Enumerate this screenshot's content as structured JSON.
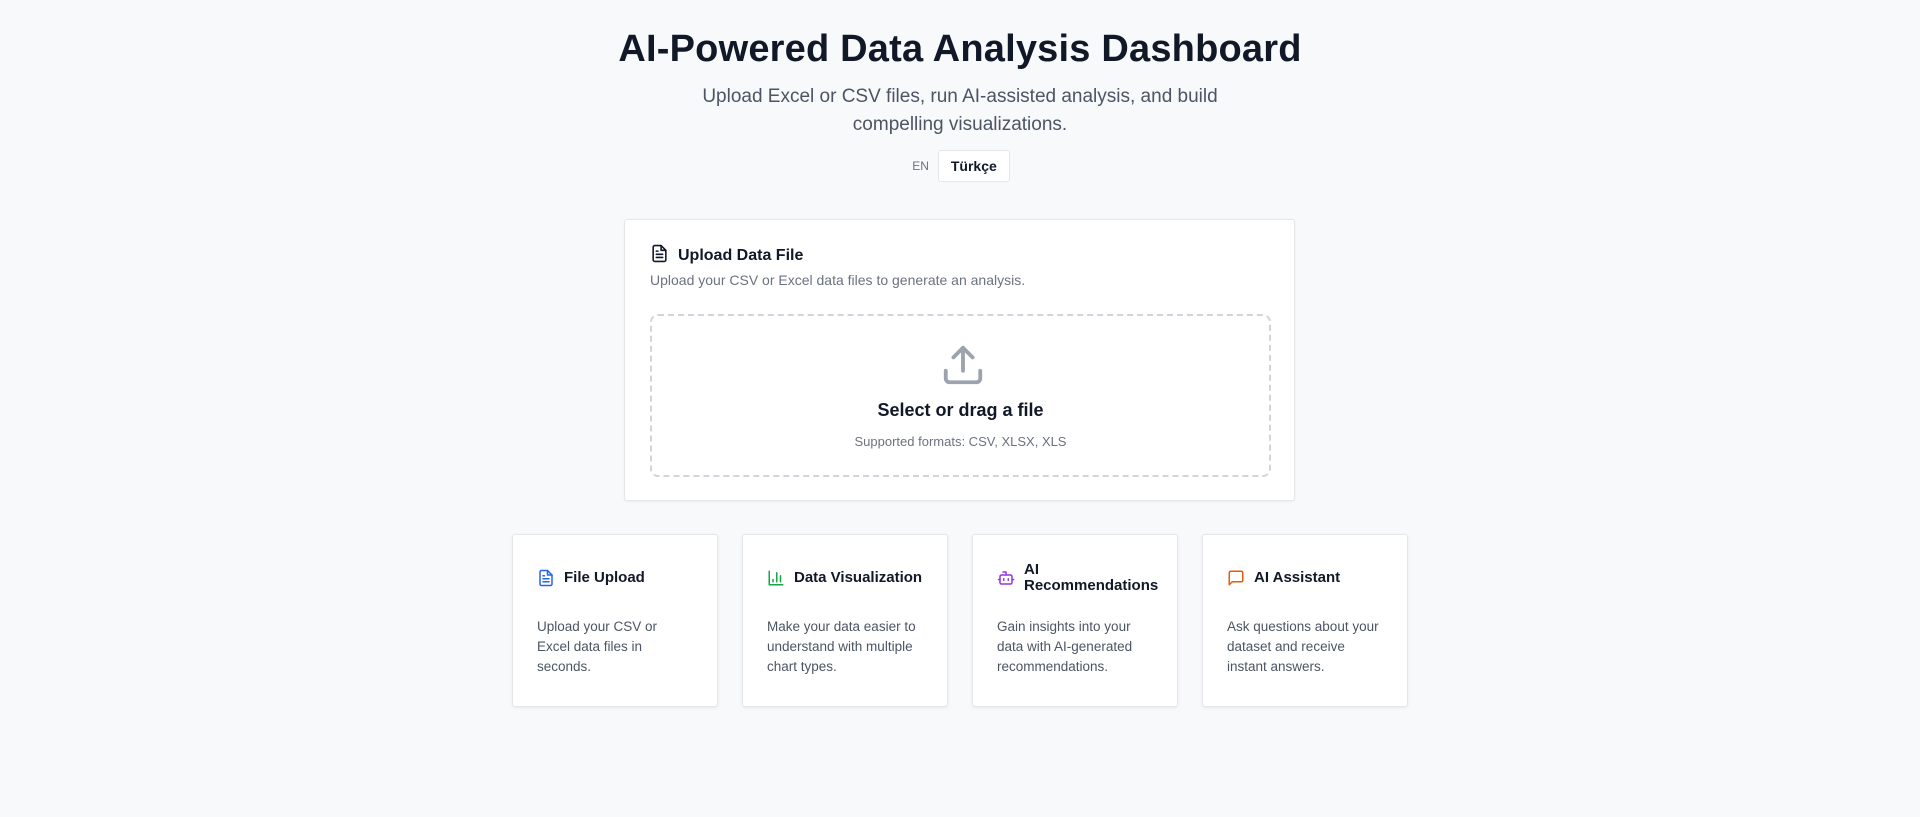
{
  "header": {
    "title": "AI-Powered Data Analysis Dashboard",
    "subtitle": "Upload Excel or CSV files, run AI-assisted analysis, and build compelling visualizations."
  },
  "language": {
    "current": "EN",
    "toggle_label": "Türkçe"
  },
  "upload": {
    "icon": "file-text-icon",
    "title": "Upload Data File",
    "description": "Upload your CSV or Excel data files to generate an analysis.",
    "dropzone": {
      "icon": "upload-icon",
      "title": "Select or drag a file",
      "formats": "Supported formats: CSV, XLSX, XLS"
    }
  },
  "features": [
    {
      "icon": "file-text-icon",
      "color": "#2563eb",
      "title": "File Upload",
      "description": "Upload your CSV or Excel data files in seconds."
    },
    {
      "icon": "bar-chart-icon",
      "color": "#16a34a",
      "title": "Data Visualization",
      "description": "Make your data easier to understand with multiple chart types."
    },
    {
      "icon": "bot-icon",
      "color": "#9333ea",
      "title": "AI Recommendations",
      "description": "Gain insights into your data with AI-generated recommendations."
    },
    {
      "icon": "message-square-icon",
      "color": "#ea580c",
      "title": "AI Assistant",
      "description": "Ask questions about your dataset and receive instant answers."
    }
  ]
}
